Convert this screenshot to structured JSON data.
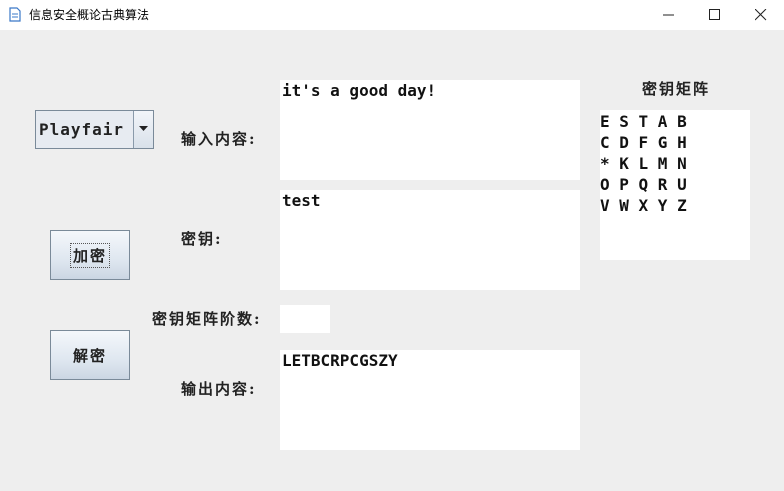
{
  "window": {
    "title": "信息安全概论古典算法"
  },
  "algorithm_select": {
    "selected": "Playfair"
  },
  "labels": {
    "input": "输入内容:",
    "key": "密钥:",
    "matrix_order": "密钥矩阵阶数:",
    "output": "输出内容:",
    "matrix_title": "密钥矩阵"
  },
  "fields": {
    "input_value": "it's a good day!",
    "key_value": "test",
    "matrix_order_value": "",
    "output_value": "LETBCRPCGSZY"
  },
  "buttons": {
    "encrypt": "加密",
    "decrypt": "解密"
  },
  "key_matrix": {
    "rows": [
      "E S T A B",
      "C D F G H",
      "* K L M N",
      "O P Q R U",
      "V W X Y Z"
    ]
  }
}
